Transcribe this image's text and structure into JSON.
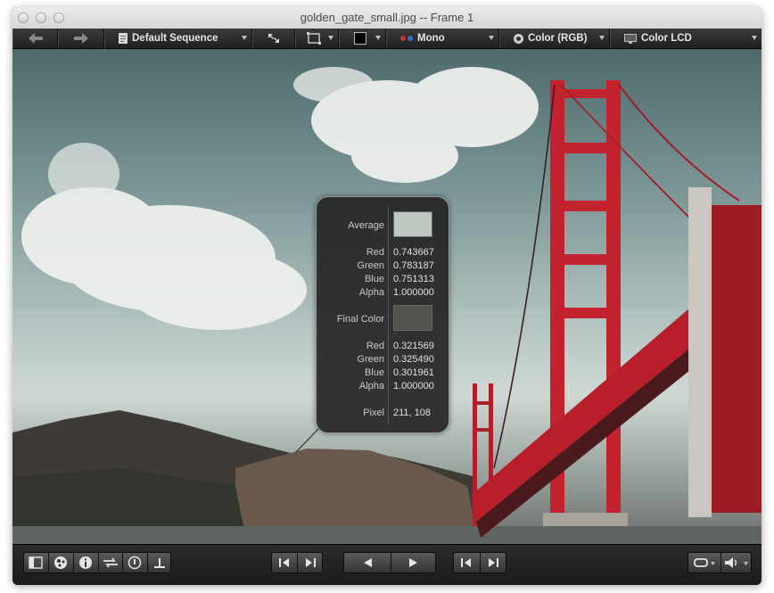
{
  "window": {
    "title": "golden_gate_small.jpg -- Frame 1"
  },
  "toolbar": {
    "back_icon": "arrow-left-icon",
    "forward_icon": "arrow-right-icon",
    "sequence_label": "Default Sequence",
    "fullscreen_icon": "expand-arrows-icon",
    "crop_icon": "frame-icon",
    "background_color": "#000000",
    "channel_label": "Mono",
    "color_label": "Color (RGB)",
    "display_label": "Color LCD"
  },
  "inspector": {
    "average_label": "Average",
    "average_color": "#bec8c0",
    "average": {
      "red_label": "Red",
      "red": "0.743667",
      "green_label": "Green",
      "green": "0.783187",
      "blue_label": "Blue",
      "blue": "0.751313",
      "alpha_label": "Alpha",
      "alpha": "1.000000"
    },
    "final_label": "Final Color",
    "final_color": "#52534d",
    "final": {
      "red_label": "Red",
      "red": "0.321569",
      "green_label": "Green",
      "green": "0.325490",
      "blue_label": "Blue",
      "blue": "0.301961",
      "alpha_label": "Alpha",
      "alpha": "1.000000"
    },
    "pixel_label": "Pixel",
    "pixel": "211, 108"
  },
  "bottom": {
    "icons": [
      "sidebar-toggle-icon",
      "color-wheel-icon",
      "info-icon",
      "swap-icon",
      "timer-icon",
      "baseline-icon"
    ],
    "playback_icons": [
      "step-back-icon",
      "step-forward-icon",
      "play-reverse-icon",
      "play-icon",
      "skip-start-icon",
      "skip-end-icon"
    ],
    "loop_icon": "loop-icon",
    "volume_icon": "volume-icon"
  }
}
